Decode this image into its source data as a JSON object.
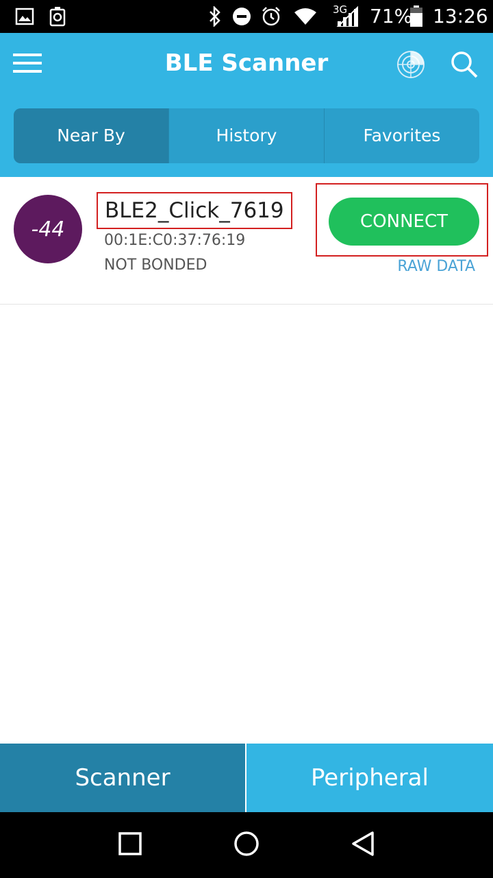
{
  "status_bar": {
    "network_type": "3G",
    "battery_percent": "71%",
    "time": "13:26",
    "left_icons": [
      "gallery-icon",
      "recycle-icon"
    ],
    "right_icons": [
      "bluetooth-icon",
      "do-not-disturb-icon",
      "alarm-icon",
      "wifi-icon",
      "signal-icon",
      "battery-icon"
    ]
  },
  "app_bar": {
    "title": "BLE Scanner",
    "menu_icon": "menu-icon",
    "radar_icon": "radar-icon",
    "search_icon": "search-icon"
  },
  "tabs": [
    {
      "label": "Near By",
      "active": true
    },
    {
      "label": "History",
      "active": false
    },
    {
      "label": "Favorites",
      "active": false
    }
  ],
  "devices": [
    {
      "rssi": "-44",
      "name": "BLE2_Click_7619",
      "mac": "00:1E:C0:37:76:19",
      "bond_state": "NOT BONDED",
      "connect_label": "CONNECT",
      "raw_data_label": "RAW DATA"
    }
  ],
  "bottom_tabs": [
    {
      "label": "Scanner",
      "active": true
    },
    {
      "label": "Peripheral",
      "active": false
    }
  ],
  "nav_bar": [
    "recents-icon",
    "home-icon",
    "back-icon"
  ],
  "colors": {
    "primary": "#33b5e3",
    "primary_dark": "#2481a6",
    "connect_green": "#20c05c",
    "rssi_purple": "#5d1a5e",
    "highlight_red": "#d32020"
  }
}
